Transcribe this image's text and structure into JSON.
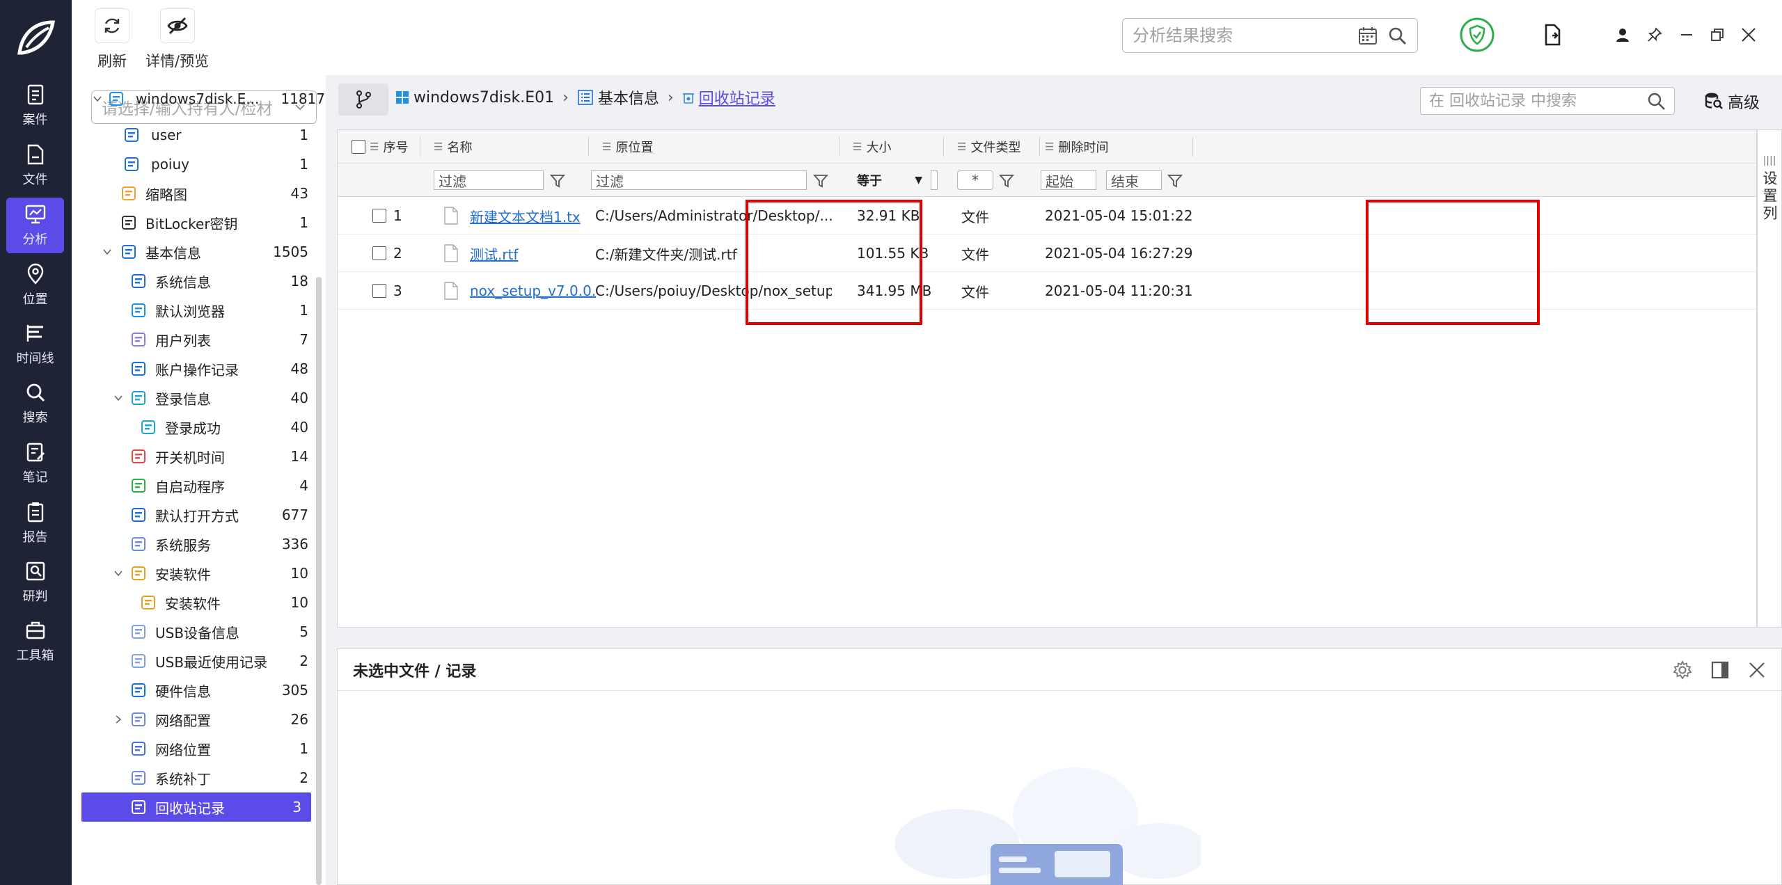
{
  "nav": {
    "items": [
      {
        "label": "案件",
        "icon": "case-icon"
      },
      {
        "label": "文件",
        "icon": "file-icon"
      },
      {
        "label": "分析",
        "icon": "analysis-icon",
        "active": true
      },
      {
        "label": "位置",
        "icon": "location-icon"
      },
      {
        "label": "时间线",
        "icon": "timeline-icon"
      },
      {
        "label": "搜索",
        "icon": "search-icon"
      },
      {
        "label": "笔记",
        "icon": "note-icon"
      },
      {
        "label": "报告",
        "icon": "report-icon"
      },
      {
        "label": "研判",
        "icon": "judge-icon"
      },
      {
        "label": "工具箱",
        "icon": "toolbox-icon"
      }
    ]
  },
  "toolbar": {
    "refresh_label": "刷新",
    "details_label": "详情/预览",
    "search_placeholder": "分析结果搜索"
  },
  "tree": {
    "select_placeholder": "请选择/输入持有人/检材",
    "rows": [
      {
        "label": "windows7disk.E...",
        "count": "11817",
        "icon": "windows-icon"
      },
      {
        "label": "user",
        "count": "1",
        "icon": "user-card-icon"
      },
      {
        "label": "poiuy",
        "count": "1",
        "icon": "user-card-icon"
      },
      {
        "label": "缩略图",
        "count": "43",
        "icon": "thumbnail-icon"
      },
      {
        "label": "BitLocker密钥",
        "count": "1",
        "icon": "key-search-icon"
      },
      {
        "label": "基本信息",
        "count": "1505",
        "icon": "list-icon"
      },
      {
        "label": "系统信息",
        "count": "18",
        "icon": "system-info-icon"
      },
      {
        "label": "默认浏览器",
        "count": "1",
        "icon": "browser-icon"
      },
      {
        "label": "用户列表",
        "count": "7",
        "icon": "user-list-icon"
      },
      {
        "label": "账户操作记录",
        "count": "48",
        "icon": "account-log-icon"
      },
      {
        "label": "登录信息",
        "count": "40",
        "icon": "login-icon"
      },
      {
        "label": "登录成功",
        "count": "40",
        "icon": "login-success-icon"
      },
      {
        "label": "开关机时间",
        "count": "14",
        "icon": "power-icon"
      },
      {
        "label": "自启动程序",
        "count": "4",
        "icon": "autostart-icon"
      },
      {
        "label": "默认打开方式",
        "count": "677",
        "icon": "apps-icon"
      },
      {
        "label": "系统服务",
        "count": "336",
        "icon": "service-icon"
      },
      {
        "label": "安装软件",
        "count": "10",
        "icon": "package-icon"
      },
      {
        "label": "安装软件",
        "count": "10",
        "icon": "package-icon"
      },
      {
        "label": "USB设备信息",
        "count": "5",
        "icon": "usb-icon"
      },
      {
        "label": "USB最近使用记录",
        "count": "2",
        "icon": "usb-icon"
      },
      {
        "label": "硬件信息",
        "count": "305",
        "icon": "chip-icon"
      },
      {
        "label": "网络配置",
        "count": "26",
        "icon": "network-config-icon"
      },
      {
        "label": "网络位置",
        "count": "1",
        "icon": "network-location-icon"
      },
      {
        "label": "系统补丁",
        "count": "2",
        "icon": "patch-icon"
      },
      {
        "label": "回收站记录",
        "count": "3",
        "icon": "recycle-bin-icon",
        "selected": true
      }
    ]
  },
  "breadcrumb": {
    "disk": "windows7disk.E01",
    "section": "基本信息",
    "current": "回收站记录"
  },
  "local_search": {
    "placeholder": "在 回收站记录 中搜索"
  },
  "advanced_label": "高级",
  "settings_column_label": "设置列",
  "table": {
    "columns": [
      "序号",
      "名称",
      "原位置",
      "大小",
      "文件类型",
      "删除时间"
    ],
    "filters": {
      "name": "过滤",
      "path": "过滤",
      "size_op": "等于",
      "type": "*",
      "start": "起始",
      "end": "结束"
    },
    "rows": [
      {
        "index": "1",
        "name": "新建文本文档1.tx",
        "path": "C:/Users/Administrator/Desktop/...",
        "size": "32.91 KB",
        "type": "文件",
        "deleted": "2021-05-04 15:01:22"
      },
      {
        "index": "2",
        "name": "测试.rtf",
        "path": "C:/新建文件夹/测试.rtf",
        "size": "101.55 KB",
        "type": "文件",
        "deleted": "2021-05-04 16:27:29"
      },
      {
        "index": "3",
        "name": "nox_setup_v7.0.0.",
        "path": "C:/Users/poiuy/Desktop/nox_setup...",
        "size": "341.95 MB",
        "type": "文件",
        "deleted": "2021-05-04 11:20:31"
      }
    ]
  },
  "detail": {
    "title": "未选中文件 / 记录"
  },
  "colors": {
    "accent": "#5b4be8",
    "nav_bg": "#1f2336",
    "highlight": "#e00000",
    "link": "#1f6fd6"
  }
}
